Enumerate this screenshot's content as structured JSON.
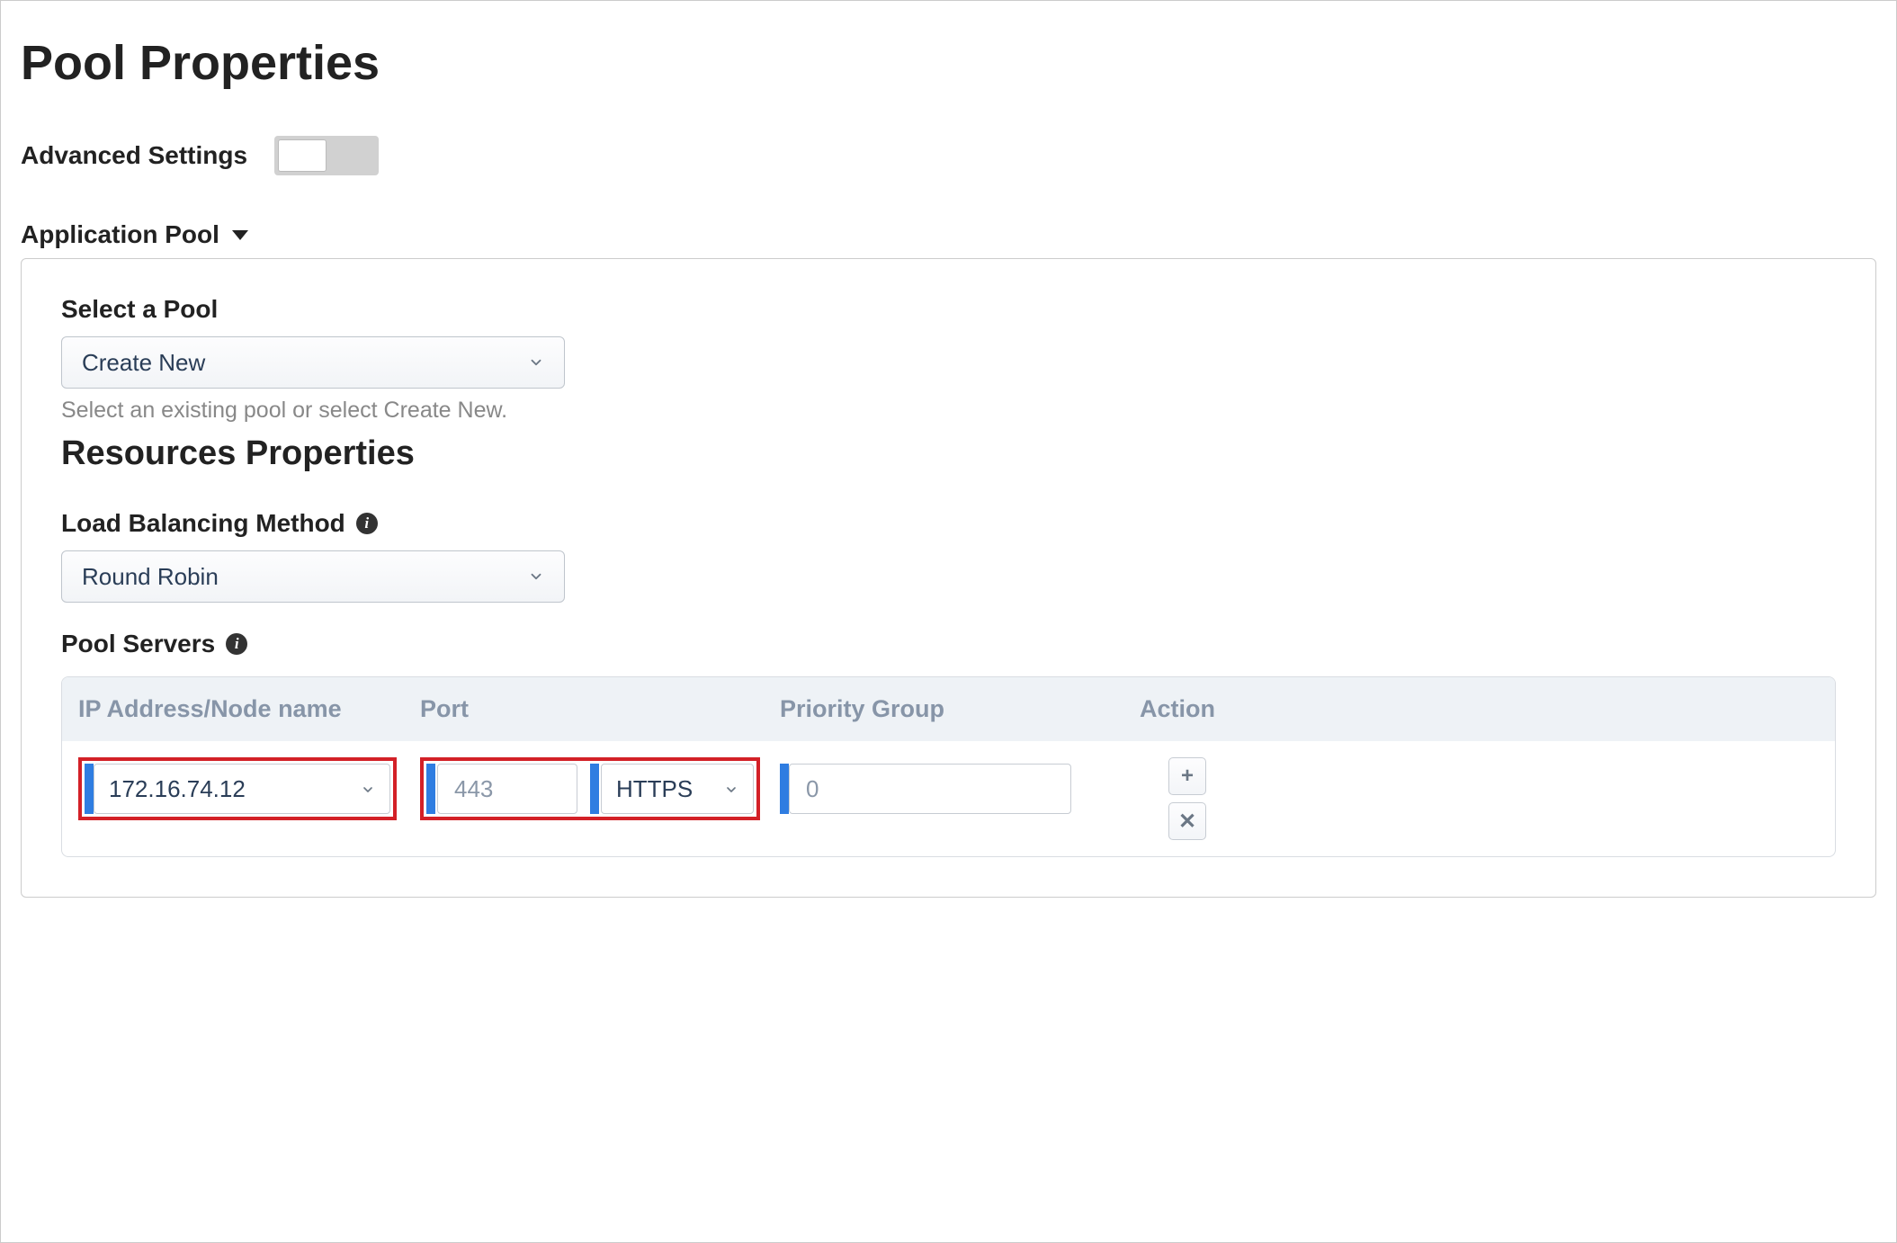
{
  "page_title": "Pool Properties",
  "advanced_settings": {
    "label": "Advanced Settings",
    "enabled": false
  },
  "application_pool": {
    "section_label": "Application Pool",
    "select_pool": {
      "label": "Select a Pool",
      "value": "Create New",
      "helper": "Select an existing pool or select Create New."
    },
    "resources_title": "Resources Properties",
    "load_balancing": {
      "label": "Load Balancing Method",
      "value": "Round Robin"
    },
    "pool_servers": {
      "label": "Pool Servers",
      "columns": {
        "ip": "IP Address/Node name",
        "port": "Port",
        "priority": "Priority Group",
        "action": "Action"
      },
      "rows": [
        {
          "ip": "172.16.74.12",
          "port_placeholder": "443",
          "protocol": "HTTPS",
          "priority_placeholder": "0"
        }
      ]
    }
  },
  "icons": {
    "plus": "+",
    "close": "✕",
    "info": "i"
  }
}
